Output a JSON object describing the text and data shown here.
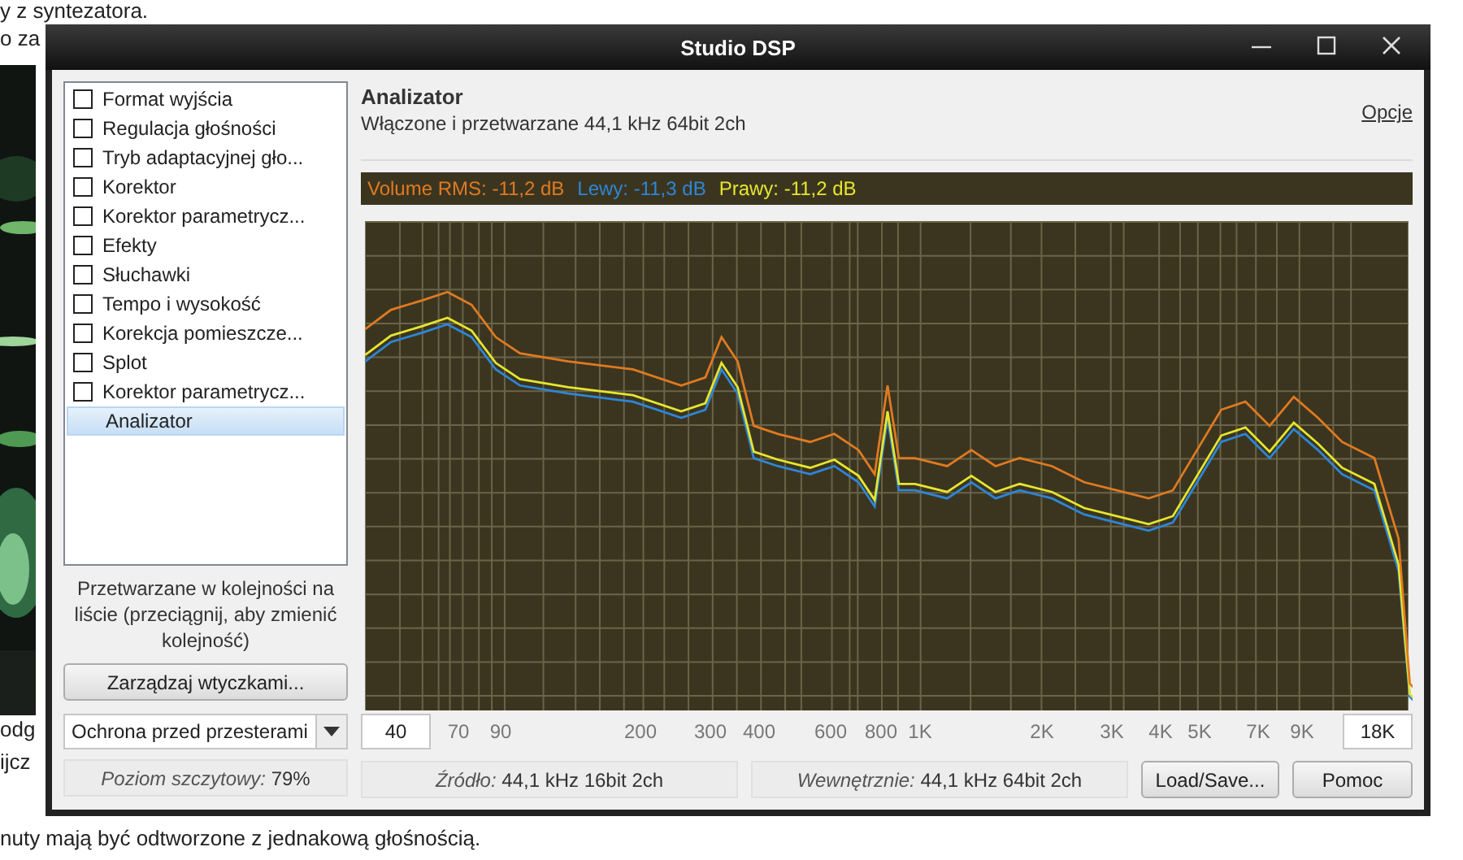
{
  "background_page": {
    "top_lines": [
      "y z syntezatora.",
      "o za"
    ],
    "bottom_lines": [
      "odg",
      "ijcz",
      "nuty mają być odtworzone z jednakową głośnością."
    ]
  },
  "window": {
    "title": "Studio DSP"
  },
  "plugins": [
    {
      "kind": "checkbox",
      "label": "Format wyjścia",
      "checked": false,
      "selected": false
    },
    {
      "kind": "checkbox",
      "label": "Regulacja głośności",
      "checked": false,
      "selected": false
    },
    {
      "kind": "checkbox",
      "label": "Tryb adaptacyjnej gło...",
      "checked": false,
      "selected": false
    },
    {
      "kind": "checkbox",
      "label": "Korektor",
      "checked": false,
      "selected": false
    },
    {
      "kind": "checkbox",
      "label": "Korektor parametrycz...",
      "checked": false,
      "selected": false
    },
    {
      "kind": "checkbox",
      "label": "Efekty",
      "checked": false,
      "selected": false
    },
    {
      "kind": "checkbox",
      "label": "Słuchawki",
      "checked": false,
      "selected": false
    },
    {
      "kind": "checkbox",
      "label": "Tempo i wysokość",
      "checked": false,
      "selected": false
    },
    {
      "kind": "checkbox",
      "label": "Korekcja pomieszcze...",
      "checked": false,
      "selected": false
    },
    {
      "kind": "checkbox",
      "label": "Splot",
      "checked": false,
      "selected": false
    },
    {
      "kind": "checkbox",
      "label": "Korektor parametrycz...",
      "checked": false,
      "selected": false
    },
    {
      "kind": "plain",
      "label": "Analizator",
      "selected": true
    }
  ],
  "plugin_hint": "Przetwarzane w kolejności na liście (przeciągnij, aby zmienić kolejność)",
  "manage_button": "Zarządzaj wtyczkami...",
  "clip_dropdown": {
    "value": "Ochrona przed przesterami"
  },
  "peak_level": "*Poziom szczytowy:* 79%",
  "panel": {
    "title": "Analizator",
    "subtitle": "Włączone i przetwarzane 44,1 kHz 64bit 2ch",
    "options_link": "Opcje"
  },
  "levels": [
    {
      "text": "Volume RMS: -11,2 dB",
      "color": "#e07a20"
    },
    {
      "text": "Lewy: -11,3 dB",
      "color": "#2e86d6"
    },
    {
      "text": "Prawy: -11,2 dB",
      "color": "#e6e62e"
    }
  ],
  "frequency_axis": {
    "min_field": "40",
    "labels": [
      "70",
      "90",
      "200",
      "300",
      "400",
      "600",
      "800",
      "1K",
      "2K",
      "3K",
      "4K",
      "5K",
      "7K",
      "9K"
    ],
    "max_field": "18K"
  },
  "status": {
    "source": "*Źródło:* 44,1 kHz 16bit 2ch",
    "internal": "*Wewnętrznie:* 44,1 kHz 64bit 2ch"
  },
  "buttons": [
    "Load/Save...",
    "Pomoc"
  ]
}
